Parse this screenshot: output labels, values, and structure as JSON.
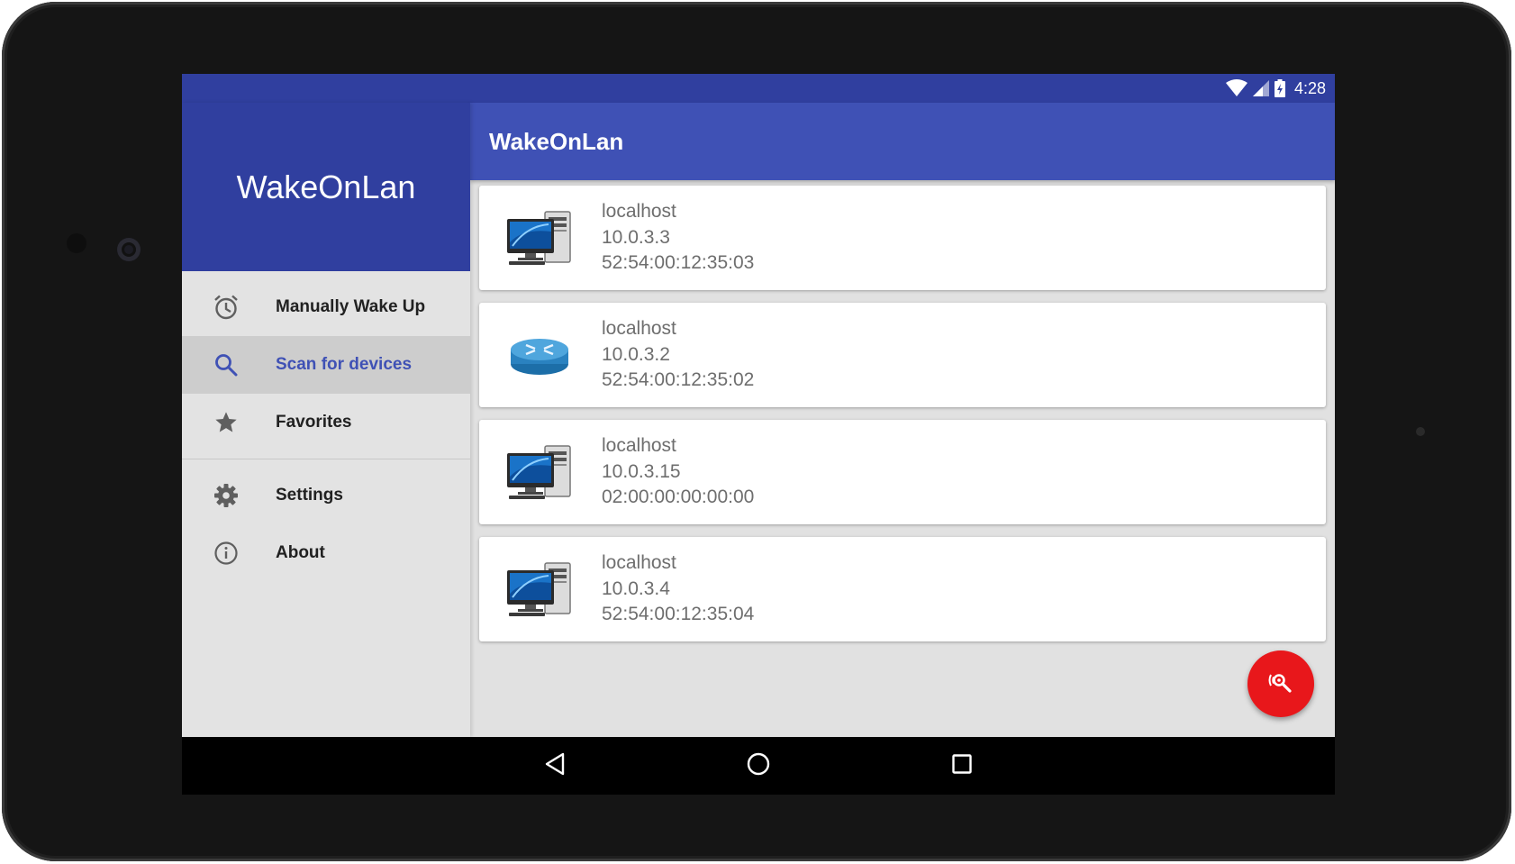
{
  "status_bar": {
    "time": "4:28",
    "icons": [
      "wifi-icon",
      "cell-signal-icon",
      "battery-charging-icon"
    ]
  },
  "drawer": {
    "header_title": "WakeOnLan",
    "items": [
      {
        "label": "Manually Wake Up",
        "icon": "alarm-icon",
        "active": false
      },
      {
        "label": "Scan for devices",
        "icon": "search-icon",
        "active": true
      },
      {
        "label": "Favorites",
        "icon": "star-icon",
        "active": false
      }
    ],
    "secondary_items": [
      {
        "label": "Settings",
        "icon": "gear-icon"
      },
      {
        "label": "About",
        "icon": "info-icon"
      }
    ]
  },
  "toolbar": {
    "title": "WakeOnLan"
  },
  "devices": [
    {
      "name": "localhost",
      "ip": "10.0.3.3",
      "mac": "52:54:00:12:35:03",
      "icon": "desktop-computer-icon"
    },
    {
      "name": "localhost",
      "ip": "10.0.3.2",
      "mac": "52:54:00:12:35:02",
      "icon": "router-icon"
    },
    {
      "name": "localhost",
      "ip": "10.0.3.15",
      "mac": "02:00:00:00:00:00",
      "icon": "desktop-computer-icon"
    },
    {
      "name": "localhost",
      "ip": "10.0.3.4",
      "mac": "52:54:00:12:35:04",
      "icon": "desktop-computer-icon"
    }
  ],
  "fab": {
    "icon": "network-scan-icon"
  },
  "nav_bar": {
    "buttons": [
      "back-icon",
      "home-icon",
      "recents-icon"
    ]
  },
  "colors": {
    "primary": "#3f51b5",
    "primary_dark": "#303f9f",
    "accent": "#e8171b"
  }
}
